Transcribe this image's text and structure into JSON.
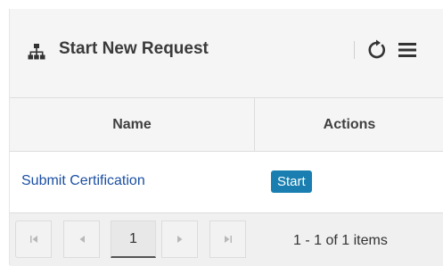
{
  "header": {
    "title": "Start New Request",
    "icon": "sitemap-icon",
    "refresh_icon": "refresh-icon",
    "menu_icon": "hamburger-menu-icon"
  },
  "table": {
    "columns": [
      "Name",
      "Actions"
    ],
    "rows": [
      {
        "name": "Submit Certification",
        "action_label": "Start"
      }
    ]
  },
  "pager": {
    "current_page": "1",
    "info": "1 - 1 of 1 items",
    "first_icon": "first-page-icon",
    "prev_icon": "previous-page-icon",
    "next_icon": "next-page-icon",
    "last_icon": "last-page-icon"
  },
  "colors": {
    "link": "#1b4fa3",
    "start_button": "#1a7fb0",
    "header_bg": "#f5f5f5"
  }
}
